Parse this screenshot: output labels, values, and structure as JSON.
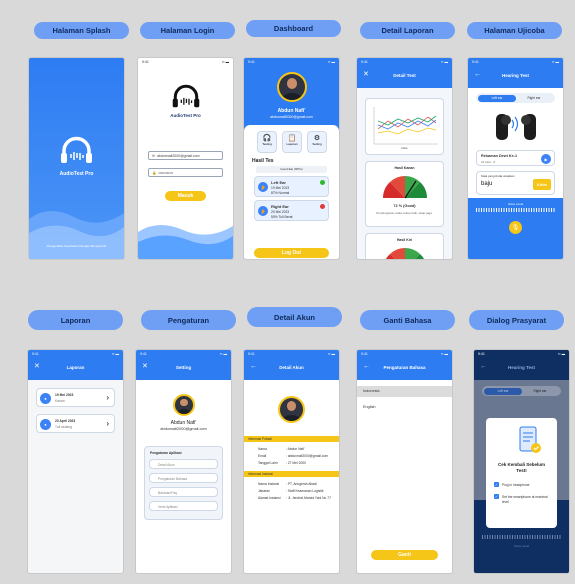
{
  "labels": {
    "splash": "Halaman Splash",
    "login": "Halaman Login",
    "dashboard": "Dashboard",
    "detail_laporan": "Detail Laporan",
    "ujicoba": "Halaman Ujicoba",
    "laporan": "Laporan",
    "pengaturan": "Pengaturan",
    "detail_akun": "Detail Akun",
    "ganti_bahasa": "Ganti Bahasa",
    "dialog": "Dialog Prasyarat"
  },
  "common": {
    "time": "9:41",
    "brand": "AudioTest Pro",
    "user_name": "Abdun Nafi'",
    "user_email": "abdunnafi2000@gmail.com"
  },
  "splash": {
    "footer": "Pengecekan Kesehatan Dengan Menyeluruh"
  },
  "login": {
    "email": "abdunnafi2000@gmail.com",
    "password": "••••••••••••",
    "button": "Masuk"
  },
  "dashboard": {
    "menu": [
      "Testing",
      "Laporan",
      "Setting"
    ],
    "section": "Hasil Tes",
    "dropdown": "Good Ear (RPG)",
    "results": [
      {
        "title": "Left Ear",
        "date": "19 Mei 2023",
        "detail": "87% Normal"
      },
      {
        "title": "Right Ear",
        "date": "20 Mei 2023",
        "detail": "50% Tuli Berat"
      }
    ],
    "logout": "Log Out"
  },
  "detail_laporan": {
    "title": "Detail Test",
    "axis": "Date",
    "gauge1": "Hasil Kanan",
    "score": "72 % (Good)",
    "note": "Pendengaran anda cukup baik, tetap jaga.",
    "gauge2": "Hasil Kiri"
  },
  "ujicoba": {
    "title": "Hearing Test",
    "tabs": [
      "Left ear",
      "Right ear"
    ],
    "card_title": "Rekaman Dewi Ke-1",
    "card_sub": "20 kata - 8",
    "prompt": "Kata yang Anda ucapkan",
    "answer": "baju",
    "send": "Kirim",
    "volume": "Voice Level"
  },
  "laporan": {
    "title": "Laporan",
    "items": [
      {
        "date": "19 Mei 2023",
        "sub": "Kanan"
      },
      {
        "date": "20 April 2023",
        "sub": "Tuli sedang"
      }
    ]
  },
  "pengaturan": {
    "title": "Setting",
    "section": "Pengaturan Aplikasi",
    "items": [
      "Detail Akun",
      "Pengaturan Bahasa",
      "Bantuan/Faq",
      "Versi Aplikasi"
    ]
  },
  "detail_akun": {
    "title": "Detail Akun",
    "sec1": "Informasi Pribadi",
    "rows1": [
      {
        "k": "Nama",
        "v": ": Abdun Nafi'"
      },
      {
        "k": "Email",
        "v": ": abdunnafi2000@gmail.com"
      },
      {
        "k": "Tanggal Lahir",
        "v": ": 27 Mei 2000"
      }
    ],
    "sec2": "Informasi Instansi",
    "rows2": [
      {
        "k": "Nama Instansi",
        "v": ": PT. Anugerah Abadi"
      },
      {
        "k": "Jabatan",
        "v": ": Staff Keamanan Logistik"
      },
      {
        "k": "Alamat Instansi",
        "v": ": Jl. Jendral Ahmad Yani No 77"
      }
    ]
  },
  "ganti_bahasa": {
    "title": "Pengaturan Bahasa",
    "langs": [
      "Indonesia",
      "English"
    ],
    "button": "Ganti"
  },
  "dialog": {
    "title": "Hearing Test",
    "tabs": [
      "Left ear",
      "Right ear"
    ],
    "heading": "Cek Kembali Sebelum Test!",
    "checks": [
      "Plug in headphone",
      "Set the smartphone at maximal level"
    ],
    "volume": "Voice Level"
  },
  "colors": {
    "blue": "#2d7cf2",
    "pill": "#6f9ff5",
    "yellow": "#f5c518"
  }
}
